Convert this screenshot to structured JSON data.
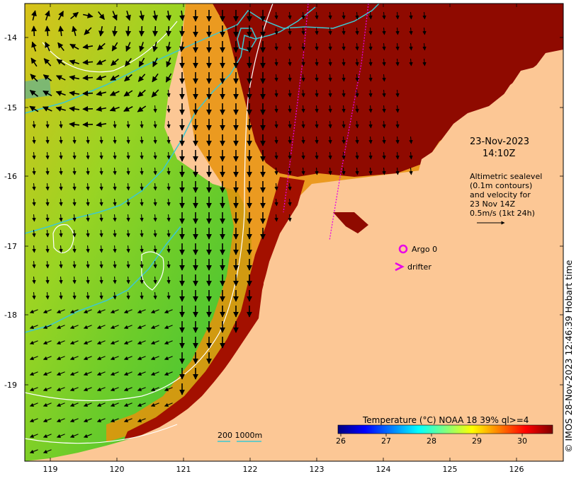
{
  "map": {
    "lon_range": [
      118.6,
      126.7
    ],
    "lat_range": [
      -20.05,
      -13.5
    ],
    "colors": {
      "land": "#fcc795",
      "sea_warm": "#8c0000",
      "sea_mid": "#f2a000",
      "sea_cool": "#3fcc2a",
      "contour": "#ffffff",
      "bathymetry": "#3cc8d2",
      "track": "#e800e8",
      "arrow": "#000000"
    }
  },
  "y_ticks": [
    "-14",
    "-15",
    "-16",
    "-17",
    "-18",
    "-19"
  ],
  "x_ticks": [
    "119",
    "120",
    "121",
    "122",
    "123",
    "124",
    "125",
    "126"
  ],
  "date_line1": "23-Nov-2023",
  "date_line2": "14:10Z",
  "altimetry": {
    "line1": "Altimetric sealevel",
    "line2": "(0.1m contours)",
    "line3": "and velocity for",
    "line4": "23 Nov 14Z",
    "line5": "0.5m/s (1kt 24h)"
  },
  "legend": {
    "argo": "Argo 0",
    "drifter": "drifter",
    "argo_icon": "circle-marker",
    "drifter_icon": "chevron-marker"
  },
  "scale_label": "200  1000m",
  "colorbar": {
    "title": "Temperature (°C) NOAA 18 39% ql>=4",
    "range": [
      26,
      30.5
    ],
    "ticks": [
      "26",
      "27",
      "28",
      "29",
      "30"
    ],
    "stops": [
      "#00007f",
      "#0000ff",
      "#007fff",
      "#00ffff",
      "#7fff7f",
      "#ffff00",
      "#ff7f00",
      "#ff0000",
      "#7f0000"
    ]
  },
  "copyright": "© IMOS 28-Nov-2023 12:46:39 Hobart time"
}
